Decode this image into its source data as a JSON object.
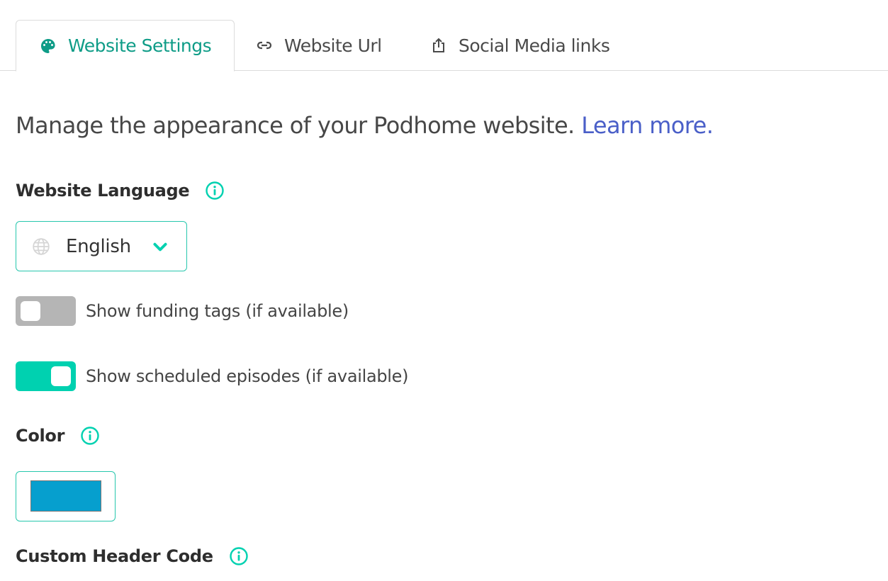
{
  "tabs": [
    {
      "label": "Website Settings",
      "icon": "palette-icon",
      "active": true
    },
    {
      "label": "Website Url",
      "icon": "link-icon",
      "active": false
    },
    {
      "label": "Social Media links",
      "icon": "share-icon",
      "active": false
    }
  ],
  "intro": {
    "text": "Manage the appearance of your Podhome website. ",
    "link": "Learn more."
  },
  "language": {
    "label": "Website Language",
    "value": "English"
  },
  "toggles": [
    {
      "label": "Show funding tags (if available)",
      "on": false
    },
    {
      "label": "Show scheduled episodes (if available)",
      "on": true
    }
  ],
  "color": {
    "label": "Color",
    "value": "#069fce"
  },
  "custom_header": {
    "label": "Custom Header Code"
  },
  "colors": {
    "accent": "#00d1b0",
    "active_tab": "#0e9c87",
    "link": "#4a5fc8",
    "toggle_off": "#b5b5b5"
  }
}
